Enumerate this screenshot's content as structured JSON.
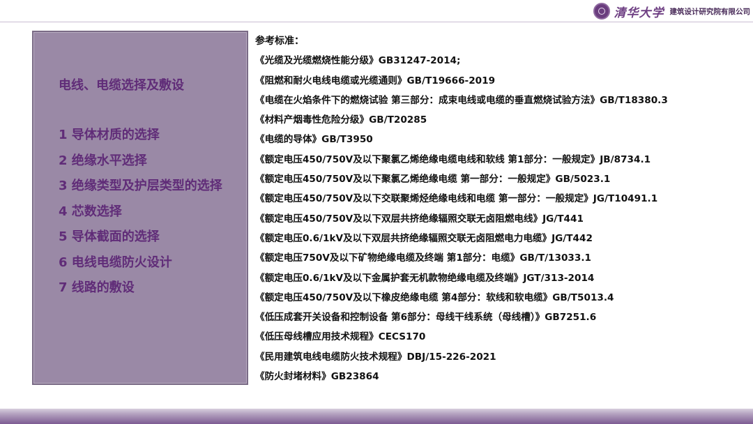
{
  "header": {
    "university": "清华大学",
    "institute": "建筑设计研究院有限公司",
    "seal_icon": "university-seal-icon"
  },
  "panel": {
    "title": "电线、电缆选择及敷设",
    "items": [
      "1 导体材质的选择",
      "2 绝缘水平选择",
      "3 绝缘类型及护层类型的选择",
      "4 芯数选择",
      "5 导体截面的选择",
      "6 电线电缆防火设计",
      "7 线路的敷设"
    ]
  },
  "references": {
    "header": "参考标准：",
    "items": [
      "《光缆及光缆燃烧性能分级》GB31247-2014;",
      "《阻燃和耐火电线电缆或光缆通则》GB/T19666-2019",
      "《电缆在火焰条件下的燃烧试验 第三部分：成束电线或电缆的垂直燃烧试验方法》GB/T18380.3",
      "《材料产烟毒性危险分级》GB/T20285",
      "《电缆的导体》GB/T3950",
      "《额定电压450/750V及以下聚氯乙烯绝缘电缆电线和软线 第1部分：一般规定》JB/8734.1",
      "《额定电压450/750V及以下聚氯乙烯绝缘电缆 第一部分：一般规定》GB/5023.1",
      "《额定电压450/750V及以下交联聚烯烃绝缘电线和电缆 第一部分：一般规定》JG/T10491.1",
      "《额定电压450/750V及以下双层共挤绝缘辐照交联无卤阻燃电线》JG/T441",
      "《额定电压0.6/1kV及以下双层共挤绝缘辐照交联无卤阻燃电力电缆》JG/T442",
      "《额定电压750V及以下矿物绝缘电缆及终端 第1部分：电缆》GB/T/13033.1",
      "《额定电压0.6/1kV及以下金属护套无机款物绝缘电缆及终端》JGT/313-2014",
      "《额定电压450/750V及以下橡皮绝缘电缆 第4部分：软线和软电缆》GB/T5013.4",
      "《低压成套开关设备和控制设备 第6部分：母线干线系统（母线槽）》GB7251.6",
      "《低压母线槽应用技术规程》CECS170",
      "《民用建筑电线电缆防火技术规程》DBJ/15-226-2021",
      "《防火封堵材料》GB23864"
    ]
  },
  "colors": {
    "panel_fill": "#9a89a6",
    "panel_text": "#602c78",
    "brand": "#6e3f83",
    "footer": "#7d5c92"
  }
}
